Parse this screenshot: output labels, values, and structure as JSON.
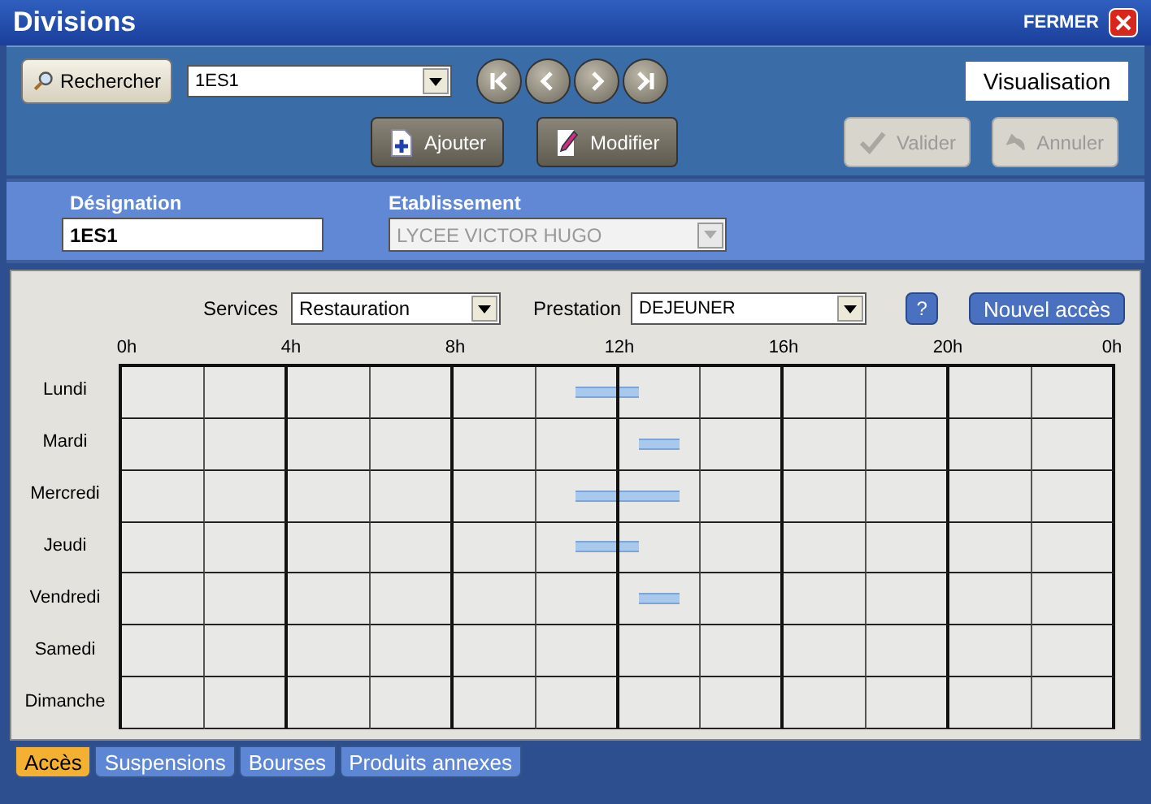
{
  "window": {
    "title": "Divisions",
    "close_label": "FERMER"
  },
  "toolbar": {
    "search_button": "Rechercher",
    "record": "1ES1",
    "add_button": "Ajouter",
    "edit_button": "Modifier",
    "validate_button": "Valider",
    "cancel_button": "Annuler",
    "mode": "Visualisation"
  },
  "form": {
    "designation_label": "Désignation",
    "designation": "1ES1",
    "establishment_label": "Etablissement",
    "establishment": "LYCEE VICTOR HUGO",
    "establishment_disabled": true
  },
  "filters": {
    "services_label": "Services",
    "services": "Restauration",
    "prestation_label": "Prestation",
    "prestation": "DEJEUNER",
    "help_button": "?",
    "new_access_button": "Nouvel accès"
  },
  "schedule": {
    "hours": [
      "0h",
      "4h",
      "8h",
      "12h",
      "16h",
      "20h",
      "0h"
    ],
    "days": [
      {
        "name": "Lundi",
        "booked": [
          false,
          false,
          false,
          false,
          false,
          false,
          false,
          false,
          false,
          false,
          false,
          false,
          false,
          false,
          false,
          false,
          false,
          false,
          false,
          false,
          false,
          false,
          true,
          true,
          true,
          false,
          false,
          false,
          false,
          false,
          false,
          false,
          false,
          false,
          false,
          false,
          false,
          false,
          false,
          false,
          false,
          false,
          false,
          false,
          false,
          false,
          false,
          false
        ]
      },
      {
        "name": "Mardi",
        "booked": [
          false,
          false,
          false,
          false,
          false,
          false,
          false,
          false,
          false,
          false,
          false,
          false,
          false,
          false,
          false,
          false,
          false,
          false,
          false,
          false,
          false,
          false,
          false,
          false,
          false,
          true,
          true,
          false,
          false,
          false,
          false,
          false,
          false,
          false,
          false,
          false,
          false,
          false,
          false,
          false,
          false,
          false,
          false,
          false,
          false,
          false,
          false,
          false
        ]
      },
      {
        "name": "Mercredi",
        "booked": [
          false,
          false,
          false,
          false,
          false,
          false,
          false,
          false,
          false,
          false,
          false,
          false,
          false,
          false,
          false,
          false,
          false,
          false,
          false,
          false,
          false,
          false,
          true,
          true,
          true,
          true,
          true,
          false,
          false,
          false,
          false,
          false,
          false,
          false,
          false,
          false,
          false,
          false,
          false,
          false,
          false,
          false,
          false,
          false,
          false,
          false,
          false,
          false
        ]
      },
      {
        "name": "Jeudi",
        "booked": [
          false,
          false,
          false,
          false,
          false,
          false,
          false,
          false,
          false,
          false,
          false,
          false,
          false,
          false,
          false,
          false,
          false,
          false,
          false,
          false,
          false,
          false,
          true,
          true,
          true,
          false,
          false,
          false,
          false,
          false,
          false,
          false,
          false,
          false,
          false,
          false,
          false,
          false,
          false,
          false,
          false,
          false,
          false,
          false,
          false,
          false,
          false,
          false
        ]
      },
      {
        "name": "Vendredi",
        "booked": [
          false,
          false,
          false,
          false,
          false,
          false,
          false,
          false,
          false,
          false,
          false,
          false,
          false,
          false,
          false,
          false,
          false,
          false,
          false,
          false,
          false,
          false,
          false,
          false,
          false,
          true,
          true,
          false,
          false,
          false,
          false,
          false,
          false,
          false,
          false,
          false,
          false,
          false,
          false,
          false,
          false,
          false,
          false,
          false,
          false,
          false,
          false,
          false
        ]
      },
      {
        "name": "Samedi",
        "booked": [
          false,
          false,
          false,
          false,
          false,
          false,
          false,
          false,
          false,
          false,
          false,
          false,
          false,
          false,
          false,
          false,
          false,
          false,
          false,
          false,
          false,
          false,
          false,
          false,
          false,
          false,
          false,
          false,
          false,
          false,
          false,
          false,
          false,
          false,
          false,
          false,
          false,
          false,
          false,
          false,
          false,
          false,
          false,
          false,
          false,
          false,
          false,
          false
        ]
      },
      {
        "name": "Dimanche",
        "booked": [
          false,
          false,
          false,
          false,
          false,
          false,
          false,
          false,
          false,
          false,
          false,
          false,
          false,
          false,
          false,
          false,
          false,
          false,
          false,
          false,
          false,
          false,
          false,
          false,
          false,
          false,
          false,
          false,
          false,
          false,
          false,
          false,
          false,
          false,
          false,
          false,
          false,
          false,
          false,
          false,
          false,
          false,
          false,
          false,
          false,
          false,
          false,
          false
        ]
      }
    ]
  },
  "tabs": [
    {
      "label": "Accès",
      "selected": true
    },
    {
      "label": "Suspensions",
      "selected": false
    },
    {
      "label": "Bourses",
      "selected": false
    },
    {
      "label": "Produits annexes",
      "selected": false
    }
  ]
}
